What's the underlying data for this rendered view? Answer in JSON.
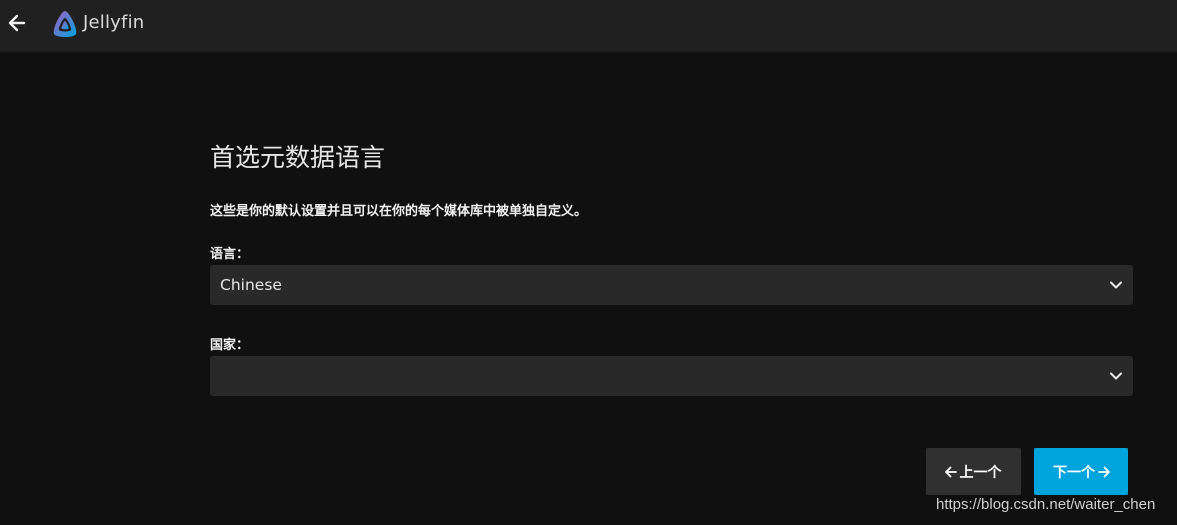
{
  "header": {
    "brand": "Jellyfin",
    "back_icon": "arrow-left-icon",
    "logo_icon": "jellyfin-logo-icon"
  },
  "main": {
    "title": "首选元数据语言",
    "description": "这些是你的默认设置并且可以在你的每个媒体库中被单独自定义。",
    "language": {
      "label": "语言：",
      "value": "Chinese"
    },
    "country": {
      "label": "国家：",
      "value": ""
    }
  },
  "buttons": {
    "prev_label": "上一个",
    "next_label": "下一个"
  },
  "watermark": "https://blog.csdn.net/waiter_chen",
  "colors": {
    "background": "#101010",
    "header": "#202020",
    "select_bg": "#292929",
    "accent": "#00a4dc",
    "secondary_button": "#303030"
  }
}
